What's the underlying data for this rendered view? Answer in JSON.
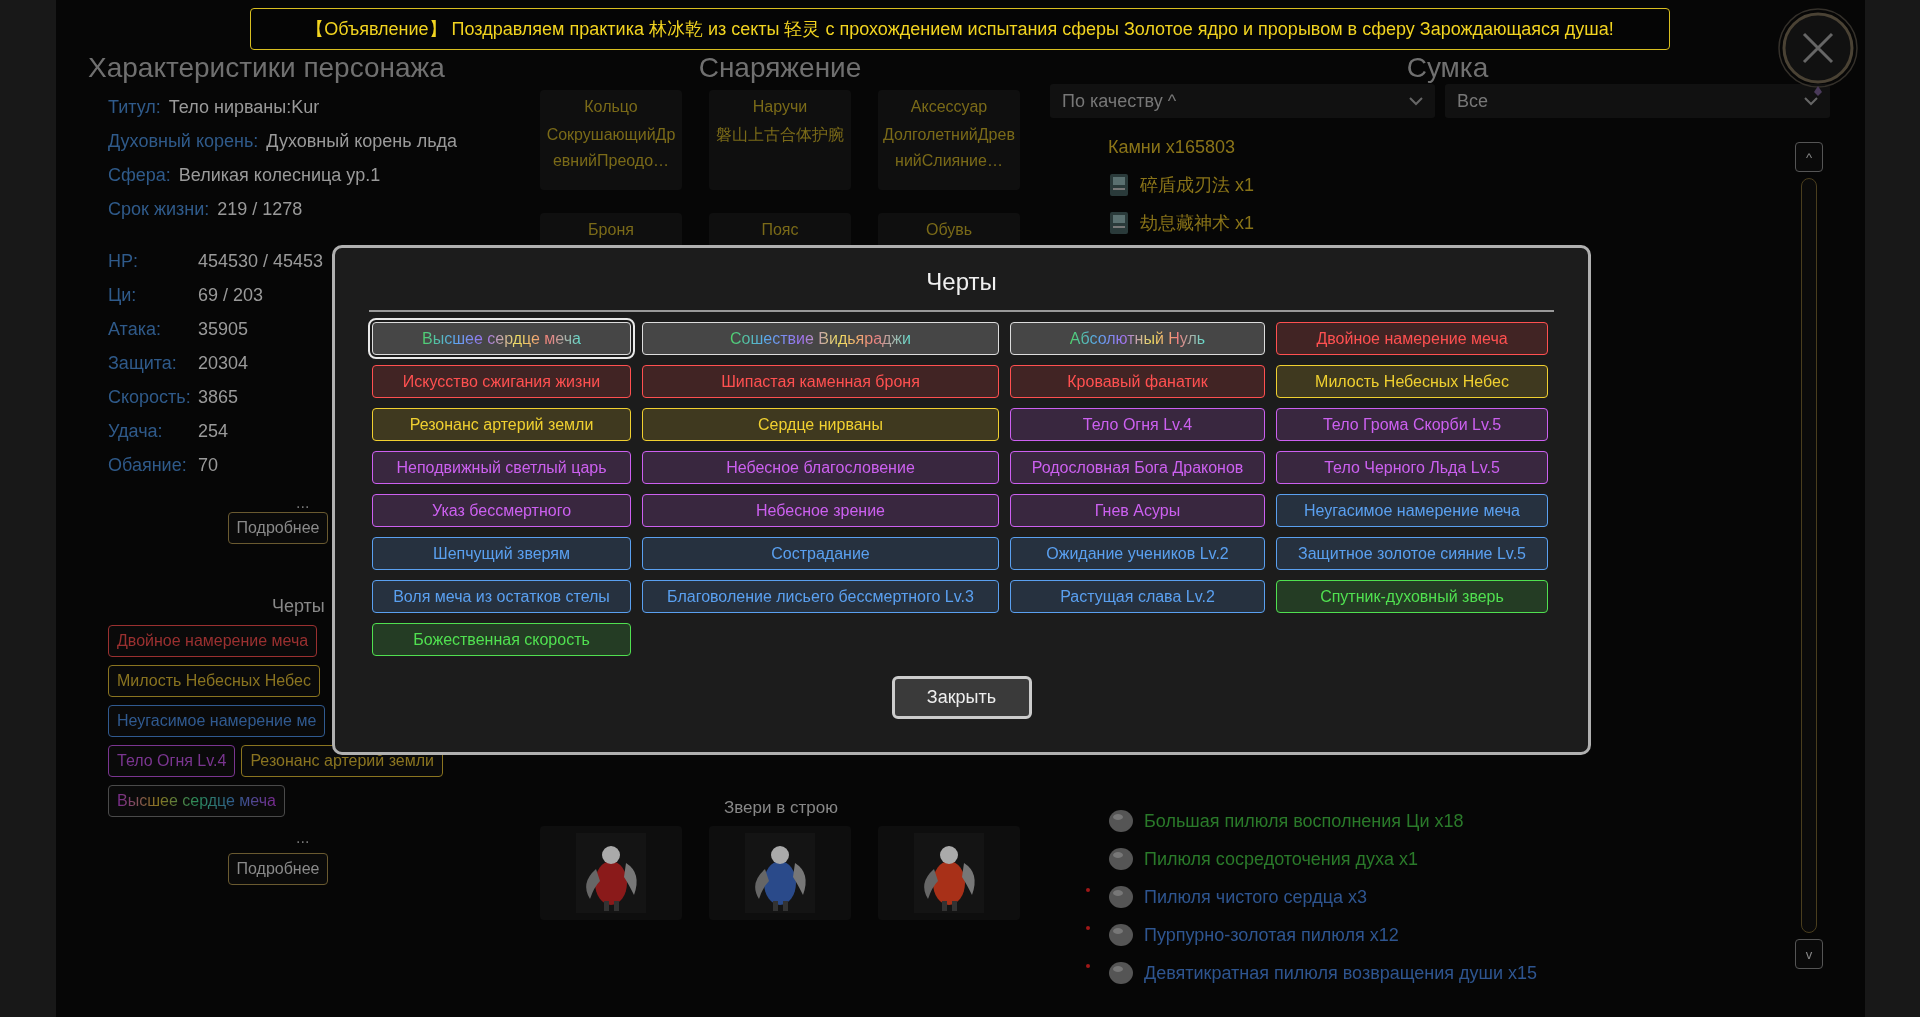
{
  "announcement": "【Объявление】 Поздравляем практика 林冰乾 из секты 轻灵 с прохождением испытания сферы Золотое ядро и прорывом в сферу Зарождающаяся душа!",
  "character": {
    "title": "Характеристики персонажа",
    "info": [
      {
        "label": "Титул:",
        "value": "Тело нирваны:Kur"
      },
      {
        "label": "Духовный корень:",
        "value": "Духовный корень льда"
      },
      {
        "label": "Сфера:",
        "value": "Великая колесница ур.1"
      },
      {
        "label": "Срок жизни:",
        "value": "219 / 1278"
      }
    ],
    "stats": [
      {
        "label": "HP:",
        "value": "454530 / 45453"
      },
      {
        "label": "Ци:",
        "value": "69 / 203"
      },
      {
        "label": "Атака:",
        "value": "35905"
      },
      {
        "label": "Защита:",
        "value": "20304"
      },
      {
        "label": "Скорость:",
        "value": "3865"
      },
      {
        "label": "Удача:",
        "value": "254"
      },
      {
        "label": "Обаяние:",
        "value": "70"
      }
    ],
    "more_dots": "...",
    "more_button": "Подробнее",
    "traits_title": "Черты",
    "trait_rows": [
      [
        {
          "label": "Двойное намерение меча",
          "kind": "plain",
          "color": "#9a3030"
        }
      ],
      [
        {
          "label": "Милость Небесных Небес",
          "kind": "plain",
          "color": "#8a7420"
        }
      ],
      [
        {
          "label": "Неугасимое намерение ме",
          "kind": "plain",
          "color": "#305a90"
        }
      ],
      [
        {
          "label": "Тело Огня Lv.4",
          "kind": "plain",
          "color": "#7a3590"
        },
        {
          "label": "Резонанс артерий земли",
          "kind": "plain",
          "color": "#8a7420"
        }
      ],
      [
        {
          "label": "Высшее сердце меча",
          "kind": "rainbow"
        }
      ]
    ],
    "traits_dots": "...",
    "traits_button": "Подробнее"
  },
  "equipment": {
    "title": "Снаряжение",
    "slots": [
      {
        "slot": "Кольцо",
        "item": "СокрушающийДревнийПреодо…"
      },
      {
        "slot": "Наручи",
        "item": "磐山上古合体护腕"
      },
      {
        "slot": "Аксессуар",
        "item": "ДолголетнийДревнийСлияние…"
      },
      {
        "slot": "Броня"
      },
      {
        "slot": "Пояс"
      },
      {
        "slot": "Обувь"
      }
    ],
    "beasts_title": "Звери в строю"
  },
  "bag": {
    "title": "Сумка",
    "sort": "По качеству ^",
    "filter": "Все",
    "scroll_up": "^",
    "scroll_down": "v",
    "items_top": [
      {
        "label": "Камни x165803",
        "kind": "currency",
        "color": "#8a7418",
        "marked": false
      },
      {
        "label": "碎盾成刃法 x1",
        "kind": "book",
        "color": "#8a7418",
        "marked": false
      },
      {
        "label": "劫息藏神术 x1",
        "kind": "book",
        "color": "#8a7418",
        "marked": false
      }
    ],
    "items_bottom": [
      {
        "label": "Большая пилюля восполнения Ци x18",
        "kind": "pill",
        "color": "#2a7a2a",
        "marked": false
      },
      {
        "label": "Пилюля сосредоточения духа x1",
        "kind": "pill",
        "color": "#2a7a2a",
        "marked": false
      },
      {
        "label": "Пилюля чистого сердца x3",
        "kind": "pill",
        "color": "#2e5590",
        "marked": true
      },
      {
        "label": "Пурпурно-золотая пилюля x12",
        "kind": "pill",
        "color": "#2e5590",
        "marked": true
      },
      {
        "label": "Девятикратная пилюля возвращения души x15",
        "kind": "pill",
        "color": "#2e5590",
        "marked": true
      }
    ]
  },
  "dialog": {
    "title": "Черты",
    "close": "Закрыть",
    "traits": [
      {
        "label": "Высшее сердце меча",
        "kind": "rainbow",
        "selected": true
      },
      {
        "label": "Сошествие Видьяраджи",
        "kind": "rainbow",
        "selected": false
      },
      {
        "label": "Абсолютный Нуль",
        "kind": "rainbow",
        "selected": false
      },
      {
        "label": "Двойное намерение меча",
        "kind": "plain",
        "color": "#ff5050",
        "selected": false
      },
      {
        "label": "Искусство сжигания жизни",
        "kind": "plain",
        "color": "#ff5050",
        "selected": false
      },
      {
        "label": "Шипастая каменная броня",
        "kind": "plain",
        "color": "#ff5050",
        "selected": false
      },
      {
        "label": "Кровавый фанатик",
        "kind": "plain",
        "color": "#ff5050",
        "selected": false
      },
      {
        "label": "Милость Небесных Небес",
        "kind": "plain",
        "color": "#f0d030",
        "selected": false
      },
      {
        "label": "Резонанс артерий земли",
        "kind": "plain",
        "color": "#f0d030",
        "selected": false
      },
      {
        "label": "Сердце нирваны",
        "kind": "plain",
        "color": "#f0d030",
        "selected": false
      },
      {
        "label": "Тело Огня Lv.4",
        "kind": "plain",
        "color": "#cc60f0",
        "selected": false
      },
      {
        "label": "Тело Грома Скорби Lv.5",
        "kind": "plain",
        "color": "#cc60f0",
        "selected": false
      },
      {
        "label": "Неподвижный светлый царь",
        "kind": "plain",
        "color": "#cc60f0",
        "selected": false
      },
      {
        "label": "Небесное благословение",
        "kind": "plain",
        "color": "#cc60f0",
        "selected": false
      },
      {
        "label": "Родословная Бога Драконов",
        "kind": "plain",
        "color": "#cc60f0",
        "selected": false
      },
      {
        "label": "Тело Черного Льда Lv.5",
        "kind": "plain",
        "color": "#cc60f0",
        "selected": false
      },
      {
        "label": "Указ бессмертного",
        "kind": "plain",
        "color": "#cc60f0",
        "selected": false
      },
      {
        "label": "Небесное зрение",
        "kind": "plain",
        "color": "#cc60f0",
        "selected": false
      },
      {
        "label": "Гнев Асуры",
        "kind": "plain",
        "color": "#cc60f0",
        "selected": false
      },
      {
        "label": "Неугасимое намерение меча",
        "kind": "plain",
        "color": "#5aa0f0",
        "selected": false
      },
      {
        "label": "Шепчущий зверям",
        "kind": "plain",
        "color": "#5aa0f0",
        "selected": false
      },
      {
        "label": "Сострадание",
        "kind": "plain",
        "color": "#5aa0f0",
        "selected": false
      },
      {
        "label": "Ожидание учеников Lv.2",
        "kind": "plain",
        "color": "#5aa0f0",
        "selected": false
      },
      {
        "label": "Защитное золотое сияние Lv.5",
        "kind": "plain",
        "color": "#5aa0f0",
        "selected": false
      },
      {
        "label": "Воля меча из остатков стелы",
        "kind": "plain",
        "color": "#5aa0f0",
        "selected": false
      },
      {
        "label": "Благоволение лисьего бессмертного Lv.3",
        "kind": "plain",
        "color": "#5aa0f0",
        "selected": false
      },
      {
        "label": "Растущая слава Lv.2",
        "kind": "plain",
        "color": "#5aa0f0",
        "selected": false
      },
      {
        "label": "Спутник-духовный зверь",
        "kind": "plain",
        "color": "#50e050",
        "selected": false
      },
      {
        "label": "Божественная скорость",
        "kind": "plain",
        "color": "#50e050",
        "selected": false
      }
    ]
  }
}
